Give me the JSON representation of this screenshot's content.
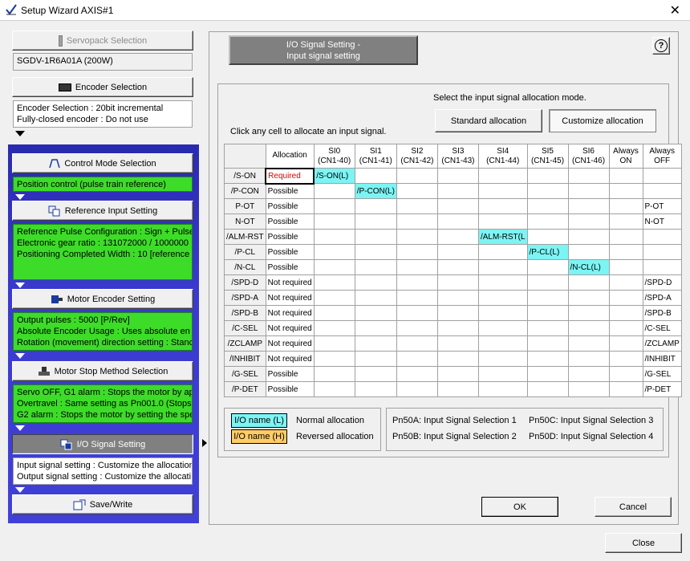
{
  "window": {
    "title": "Setup Wizard AXIS#1"
  },
  "left": {
    "servopack": {
      "label": "Servopack Selection",
      "value": "SGDV-1R6A01A (200W)"
    },
    "encoder": {
      "label": "Encoder Selection",
      "lines": [
        "Encoder Selection : 20bit incremental",
        "Fully-closed encoder : Do not use"
      ]
    },
    "control": {
      "label": "Control Mode Selection",
      "lines": [
        "Position control (pulse train reference)"
      ]
    },
    "reference": {
      "label": "Reference Input Setting",
      "lines": [
        "Reference Pulse Configuration : Sign + Pulse",
        "Electronic gear ratio : 131072000 / 1000000",
        "Positioning Completed Width : 10 [reference"
      ]
    },
    "motorenc": {
      "label": "Motor Encoder Setting",
      "lines": [
        "Output pulses : 5000 [P/Rev]",
        "Absolute Encoder Usage : Uses absolute en",
        "Rotation (movement) direction setting : Stanc"
      ]
    },
    "motorstop": {
      "label": "Motor Stop Method Selection",
      "lines": [
        "Servo OFF, G1 alarm : Stops the motor by ap",
        "Overtravel : Same setting as Pn001.0 (Stops",
        "G2 alarm : Stops the motor by setting the spe"
      ]
    },
    "io": {
      "label": "I/O Signal Setting",
      "lines": [
        "Input signal setting : Customize the allocation",
        "Output signal setting : Customize the allocati"
      ]
    },
    "save": {
      "label": "Save/Write"
    }
  },
  "right": {
    "header_line1": "I/O Signal Setting -",
    "header_line2": "Input signal setting",
    "help": "?",
    "mode_prompt": "Select the input signal allocation mode.",
    "standard_btn": "Standard allocation",
    "custom_btn": "Customize allocation",
    "click_hint": "Click any cell to allocate an input signal.",
    "columns": [
      {
        "l1": "Allocation",
        "l2": ""
      },
      {
        "l1": "SI0",
        "l2": "(CN1-40)"
      },
      {
        "l1": "SI1",
        "l2": "(CN1-41)"
      },
      {
        "l1": "SI2",
        "l2": "(CN1-42)"
      },
      {
        "l1": "SI3",
        "l2": "(CN1-43)"
      },
      {
        "l1": "SI4",
        "l2": "(CN1-44)"
      },
      {
        "l1": "SI5",
        "l2": "(CN1-45)"
      },
      {
        "l1": "SI6",
        "l2": "(CN1-46)"
      },
      {
        "l1": "Always",
        "l2": "ON"
      },
      {
        "l1": "Always",
        "l2": "OFF"
      }
    ],
    "rows": [
      {
        "sig": "/S-ON",
        "alloc": "Required",
        "cells": [
          "/S-ON(L)",
          "",
          "",
          "",
          "",
          "",
          "",
          "",
          ""
        ]
      },
      {
        "sig": "/P-CON",
        "alloc": "Possible",
        "cells": [
          "",
          "/P-CON(L)",
          "",
          "",
          "",
          "",
          "",
          "",
          ""
        ]
      },
      {
        "sig": "P-OT",
        "alloc": "Possible",
        "cells": [
          "",
          "",
          "",
          "",
          "",
          "",
          "",
          "",
          "P-OT"
        ]
      },
      {
        "sig": "N-OT",
        "alloc": "Possible",
        "cells": [
          "",
          "",
          "",
          "",
          "",
          "",
          "",
          "",
          "N-OT"
        ]
      },
      {
        "sig": "/ALM-RST",
        "alloc": "Possible",
        "cells": [
          "",
          "",
          "",
          "",
          "/ALM-RST(L",
          "",
          "",
          "",
          ""
        ]
      },
      {
        "sig": "/P-CL",
        "alloc": "Possible",
        "cells": [
          "",
          "",
          "",
          "",
          "",
          "/P-CL(L)",
          "",
          "",
          ""
        ]
      },
      {
        "sig": "/N-CL",
        "alloc": "Possible",
        "cells": [
          "",
          "",
          "",
          "",
          "",
          "",
          "/N-CL(L)",
          "",
          ""
        ]
      },
      {
        "sig": "/SPD-D",
        "alloc": "Not required",
        "cells": [
          "",
          "",
          "",
          "",
          "",
          "",
          "",
          "",
          "/SPD-D"
        ]
      },
      {
        "sig": "/SPD-A",
        "alloc": "Not required",
        "cells": [
          "",
          "",
          "",
          "",
          "",
          "",
          "",
          "",
          "/SPD-A"
        ]
      },
      {
        "sig": "/SPD-B",
        "alloc": "Not required",
        "cells": [
          "",
          "",
          "",
          "",
          "",
          "",
          "",
          "",
          "/SPD-B"
        ]
      },
      {
        "sig": "/C-SEL",
        "alloc": "Not required",
        "cells": [
          "",
          "",
          "",
          "",
          "",
          "",
          "",
          "",
          "/C-SEL"
        ]
      },
      {
        "sig": "/ZCLAMP",
        "alloc": "Not required",
        "cells": [
          "",
          "",
          "",
          "",
          "",
          "",
          "",
          "",
          "/ZCLAMP"
        ]
      },
      {
        "sig": "/INHIBIT",
        "alloc": "Not required",
        "cells": [
          "",
          "",
          "",
          "",
          "",
          "",
          "",
          "",
          "/INHIBIT"
        ]
      },
      {
        "sig": "/G-SEL",
        "alloc": "Possible",
        "cells": [
          "",
          "",
          "",
          "",
          "",
          "",
          "",
          "",
          "/G-SEL"
        ]
      },
      {
        "sig": "/P-DET",
        "alloc": "Possible",
        "cells": [
          "",
          "",
          "",
          "",
          "",
          "",
          "",
          "",
          "/P-DET"
        ]
      }
    ],
    "legend": {
      "l_swatch": "I/O name (L)",
      "l_text": "Normal allocation",
      "h_swatch": "I/O name (H)",
      "h_text": "Reversed allocation",
      "pn50a": "Pn50A:  Input Signal Selection 1",
      "pn50b": "Pn50B:  Input Signal Selection 2",
      "pn50c": "Pn50C:  Input Signal Selection 3",
      "pn50d": "Pn50D:  Input Signal Selection 4"
    },
    "ok": "OK",
    "cancel": "Cancel"
  },
  "close": "Close",
  "colors": {
    "green": "#3ddc28",
    "cyan": "#7df4f4",
    "orange": "#ffcc66",
    "blue": "#3a3ad0"
  }
}
